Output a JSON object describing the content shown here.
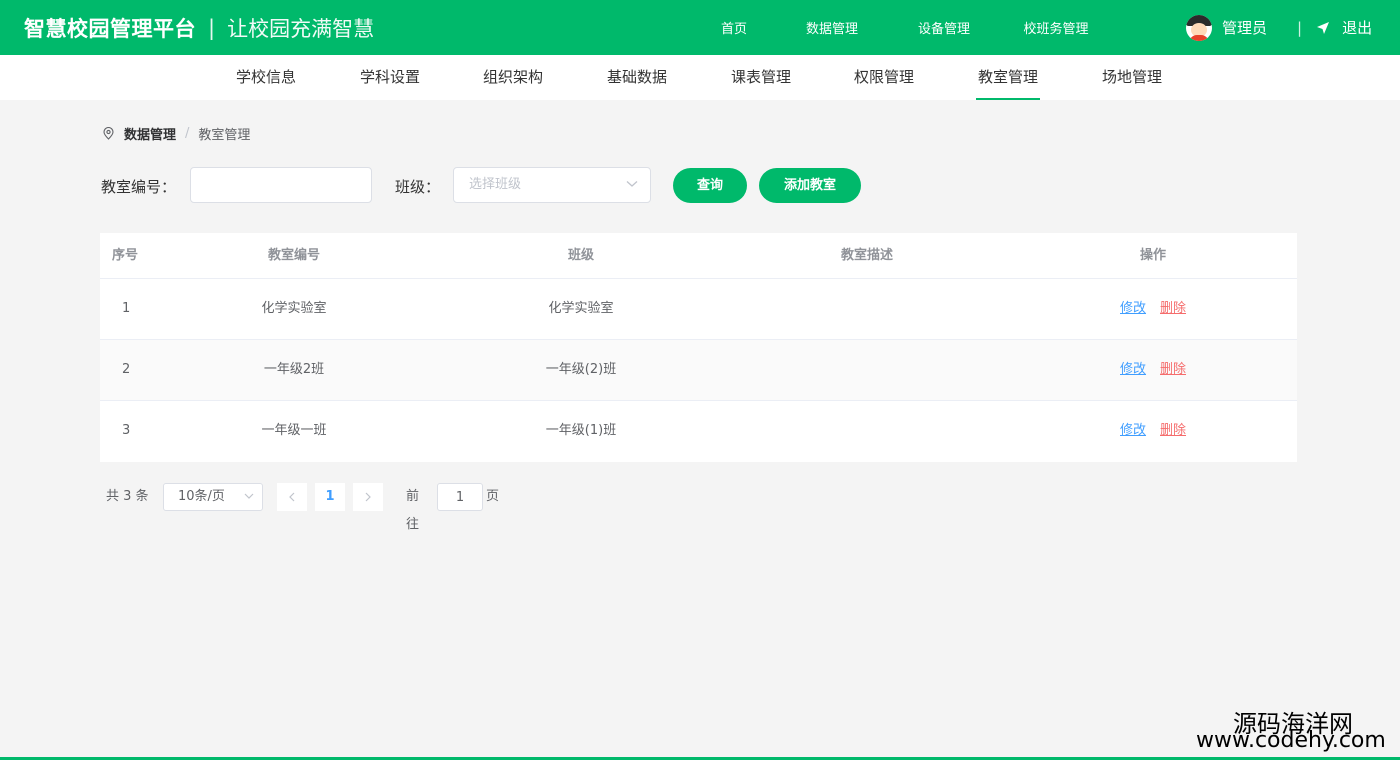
{
  "header": {
    "title": "智慧校园管理平台",
    "separator": "|",
    "slogan": "让校园充满智慧",
    "nav": [
      "首页",
      "数据管理",
      "设备管理",
      "校班务管理"
    ],
    "user_name": "管理员",
    "divider": "|",
    "logout_label": "退出",
    "accent_color": "#00b96b"
  },
  "subnav": {
    "items": [
      "学校信息",
      "学科设置",
      "组织架构",
      "基础数据",
      "课表管理",
      "权限管理",
      "教室管理",
      "场地管理"
    ],
    "active": "教室管理"
  },
  "breadcrumb": {
    "level1": "数据管理",
    "separator": "/",
    "level2": "教室管理"
  },
  "search": {
    "room_label": "教室编号：",
    "room_value": "",
    "class_label": "班级：",
    "class_placeholder": "选择班级",
    "query_button": "查询",
    "add_button": "添加教室"
  },
  "table": {
    "columns": [
      "序号",
      "教室编号",
      "班级",
      "教室描述",
      "操作"
    ],
    "rows": [
      {
        "index": "1",
        "room": "化学实验室",
        "class": "化学实验室",
        "desc": "",
        "edit": "修改",
        "delete": "删除"
      },
      {
        "index": "2",
        "room": "一年级2班",
        "class": "一年级(2)班",
        "desc": "",
        "edit": "修改",
        "delete": "删除"
      },
      {
        "index": "3",
        "room": "一年级一班",
        "class": "一年级(1)班",
        "desc": "",
        "edit": "修改",
        "delete": "删除"
      }
    ]
  },
  "pagination": {
    "total_text": "共 3 条",
    "page_size": "10条/页",
    "prev_icon": "chevron-left-icon",
    "current_page": "1",
    "next_icon": "chevron-right-icon",
    "goto_label": "前往",
    "goto_value": "1",
    "goto_suffix": "页"
  },
  "watermark": {
    "line1": "源码海洋网",
    "line2": "www.codehy.com"
  }
}
